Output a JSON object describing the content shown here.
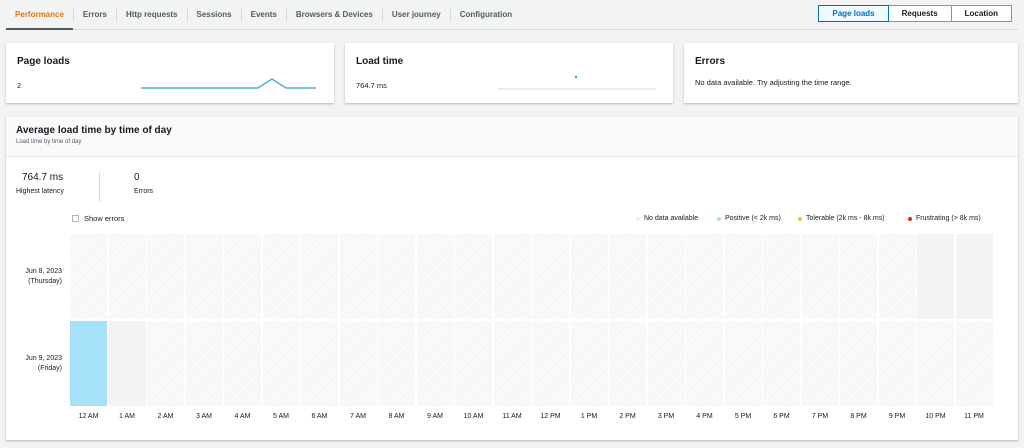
{
  "tabs": [
    "Performance",
    "Errors",
    "Http requests",
    "Sessions",
    "Events",
    "Browsers & Devices",
    "User journey",
    "Configuration"
  ],
  "view_toggle": [
    "Page loads",
    "Requests",
    "Location"
  ],
  "cards": {
    "page_loads": {
      "title": "Page loads",
      "value": "2"
    },
    "load_time": {
      "title": "Load time",
      "value": "764.7 ms"
    },
    "errors": {
      "title": "Errors",
      "message": "No data available. Try adjusting the time range."
    }
  },
  "heatmap": {
    "title": "Average load time by time of day",
    "subtitle": "Load time by time of day",
    "highest_latency": "764.7 ms",
    "highest_latency_label": "Highest latency",
    "errors": "0",
    "errors_label": "Errors",
    "show_errors": "Show errors",
    "legend": [
      {
        "label": "No data available",
        "color": "#eaeded"
      },
      {
        "label": "Positive (< 2k ms)",
        "color": "#a6e2f7"
      },
      {
        "label": "Tolerable (2k ms - 8k ms)",
        "color": "#f5b942"
      },
      {
        "label": "Frustrating (> 8k ms)",
        "color": "#d13212"
      }
    ],
    "rows": [
      {
        "date": "Jun 8, 2023",
        "day": "(Thursday)"
      },
      {
        "date": "Jun 9, 2023",
        "day": "(Friday)"
      }
    ],
    "hours": [
      "12 AM",
      "1 AM",
      "2 AM",
      "3 AM",
      "4 AM",
      "5 AM",
      "6 AM",
      "7 AM",
      "8 AM",
      "9 AM",
      "10 AM",
      "11 AM",
      "12 PM",
      "1 PM",
      "2 PM",
      "3 PM",
      "4 PM",
      "5 PM",
      "6 PM",
      "7 PM",
      "8 PM",
      "9 PM",
      "10 PM",
      "11 PM"
    ],
    "cells": [
      {
        "row": 0,
        "hour": 22,
        "status": "nodata"
      },
      {
        "row": 0,
        "hour": 23,
        "status": "nodata"
      },
      {
        "row": 1,
        "hour": 0,
        "status": "positive"
      },
      {
        "row": 1,
        "hour": 1,
        "status": "nodata"
      }
    ]
  }
}
